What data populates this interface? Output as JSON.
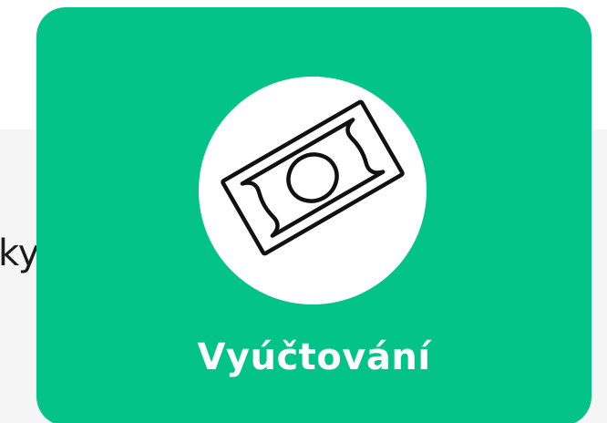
{
  "background_text": "ky",
  "card": {
    "label": "Vyúčtování",
    "icon": "banknote-icon",
    "accent_color": "#03c389"
  }
}
